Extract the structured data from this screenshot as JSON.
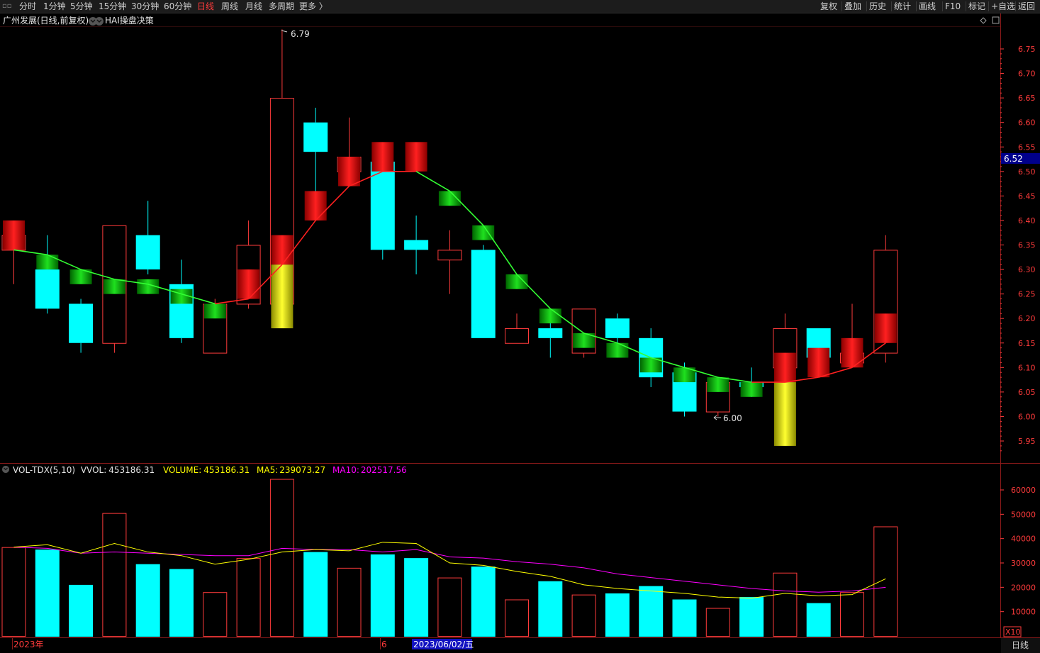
{
  "toolbar": {
    "left": [
      "分时",
      "1分钟",
      "5分钟",
      "15分钟",
      "30分钟",
      "60分钟",
      "日线",
      "周线",
      "月线",
      "多周期",
      "更多 〉"
    ],
    "active": "日线",
    "right": [
      "复权",
      "叠加",
      "历史",
      "统计",
      "画线",
      "F10",
      "标记",
      "+自选",
      "返回"
    ]
  },
  "price_panel": {
    "stock_title": "广州发展(日线,前复权)",
    "indicator": "HAI操盘决策",
    "current_price": "6.52",
    "high_marker": "6.79",
    "low_marker": "6.00",
    "axis_ticks": [
      "6.75",
      "6.70",
      "6.65",
      "6.60",
      "6.55",
      "6.50",
      "6.45",
      "6.40",
      "6.35",
      "6.30",
      "6.25",
      "6.20",
      "6.15",
      "6.10",
      "6.05",
      "6.00",
      "5.95"
    ]
  },
  "volume_panel": {
    "title": "VOL-TDX(5,10)",
    "vvol_label": "VVOL:",
    "vvol_value": "453186.31",
    "volume_label": "VOLUME:",
    "volume_value": "453186.31",
    "ma5_label": "MA5:",
    "ma5_value": "239073.27",
    "ma10_label": "MA10:",
    "ma10_value": "202517.56",
    "axis_ticks": [
      "60000",
      "50000",
      "40000",
      "30000",
      "20000",
      "10000"
    ],
    "multiplier": "X10"
  },
  "date_bar": {
    "year_label": "2023年",
    "month_label": "6",
    "cursor_date": "2023/06/02/五",
    "period": "日线"
  },
  "colors": {
    "up": "#ff3b3b",
    "down": "#00ffff",
    "hai_up": "#ff1a1a",
    "hai_down": "#17c817",
    "hai_vol": "#ffff00",
    "ma_up": "#ff2020",
    "ma_down": "#33ff33",
    "ma5": "#ffff00",
    "ma10": "#ff00ff",
    "axis": "#ff3b3b",
    "current_bg": "#00008b"
  },
  "chart_data": {
    "type": "candlestick",
    "title": "广州发展(日线,前复权)",
    "ylim": [
      5.92,
      6.8
    ],
    "candles": [
      {
        "o": 6.34,
        "c": 6.37,
        "h": 6.38,
        "l": 6.27
      },
      {
        "o": 6.3,
        "c": 6.22,
        "h": 6.37,
        "l": 6.21
      },
      {
        "o": 6.23,
        "c": 6.15,
        "h": 6.24,
        "l": 6.13
      },
      {
        "o": 6.15,
        "c": 6.39,
        "h": 6.39,
        "l": 6.13
      },
      {
        "o": 6.37,
        "c": 6.3,
        "h": 6.44,
        "l": 6.29
      },
      {
        "o": 6.27,
        "c": 6.16,
        "h": 6.32,
        "l": 6.15
      },
      {
        "o": 6.13,
        "c": 6.23,
        "h": 6.24,
        "l": 6.13
      },
      {
        "o": 6.23,
        "c": 6.35,
        "h": 6.4,
        "l": 6.22
      },
      {
        "o": 6.23,
        "c": 6.65,
        "h": 6.79,
        "l": 6.21
      },
      {
        "o": 6.6,
        "c": 6.54,
        "h": 6.63,
        "l": 6.42
      },
      {
        "o": 6.5,
        "c": 6.53,
        "h": 6.61,
        "l": 6.48
      },
      {
        "o": 6.52,
        "c": 6.34,
        "h": 6.53,
        "l": 6.32
      },
      {
        "o": 6.36,
        "c": 6.34,
        "h": 6.41,
        "l": 6.29
      },
      {
        "o": 6.32,
        "c": 6.34,
        "h": 6.38,
        "l": 6.25
      },
      {
        "o": 6.34,
        "c": 6.16,
        "h": 6.35,
        "l": 6.16
      },
      {
        "o": 6.15,
        "c": 6.18,
        "h": 6.21,
        "l": 6.15
      },
      {
        "o": 6.18,
        "c": 6.16,
        "h": 6.22,
        "l": 6.12
      },
      {
        "o": 6.13,
        "c": 6.22,
        "h": 6.22,
        "l": 6.12
      },
      {
        "o": 6.2,
        "c": 6.16,
        "h": 6.21,
        "l": 6.15
      },
      {
        "o": 6.16,
        "c": 6.08,
        "h": 6.18,
        "l": 6.06
      },
      {
        "o": 6.09,
        "c": 6.01,
        "h": 6.11,
        "l": 6.0
      },
      {
        "o": 6.01,
        "c": 6.07,
        "h": 6.07,
        "l": 6.0
      },
      {
        "o": 6.07,
        "c": 6.06,
        "h": 6.1,
        "l": 6.04
      },
      {
        "o": 6.1,
        "c": 6.18,
        "h": 6.21,
        "l": 6.06
      },
      {
        "o": 6.18,
        "c": 6.12,
        "h": 6.18,
        "l": 6.11
      },
      {
        "o": 6.11,
        "c": 6.13,
        "h": 6.23,
        "l": 6.11
      },
      {
        "o": 6.13,
        "c": 6.34,
        "h": 6.37,
        "l": 6.11
      }
    ],
    "hai_blocks": [
      {
        "top": 6.4,
        "bottom": 6.34,
        "dir": "up",
        "vol": false
      },
      {
        "top": 6.33,
        "bottom": 6.3,
        "dir": "down",
        "vol": false
      },
      {
        "top": 6.3,
        "bottom": 6.27,
        "dir": "down",
        "vol": false
      },
      {
        "top": 6.28,
        "bottom": 6.25,
        "dir": "down",
        "vol": false
      },
      {
        "top": 6.28,
        "bottom": 6.25,
        "dir": "down",
        "vol": false
      },
      {
        "top": 6.26,
        "bottom": 6.23,
        "dir": "down",
        "vol": false
      },
      {
        "top": 6.23,
        "bottom": 6.2,
        "dir": "down",
        "vol": false
      },
      {
        "top": 6.3,
        "bottom": 6.24,
        "dir": "up",
        "vol": false
      },
      {
        "top": 6.37,
        "bottom": 6.31,
        "dir": "up",
        "vol": true,
        "vol_bottom": 6.18
      },
      {
        "top": 6.46,
        "bottom": 6.4,
        "dir": "up",
        "vol": false
      },
      {
        "top": 6.53,
        "bottom": 6.47,
        "dir": "up",
        "vol": false
      },
      {
        "top": 6.56,
        "bottom": 6.5,
        "dir": "up",
        "vol": false
      },
      {
        "top": 6.56,
        "bottom": 6.5,
        "dir": "up",
        "vol": false
      },
      {
        "top": 6.46,
        "bottom": 6.43,
        "dir": "down",
        "vol": false
      },
      {
        "top": 6.39,
        "bottom": 6.36,
        "dir": "down",
        "vol": false
      },
      {
        "top": 6.29,
        "bottom": 6.26,
        "dir": "down",
        "vol": false
      },
      {
        "top": 6.22,
        "bottom": 6.19,
        "dir": "down",
        "vol": false
      },
      {
        "top": 6.17,
        "bottom": 6.14,
        "dir": "down",
        "vol": false
      },
      {
        "top": 6.15,
        "bottom": 6.12,
        "dir": "down",
        "vol": false
      },
      {
        "top": 6.12,
        "bottom": 6.09,
        "dir": "down",
        "vol": false
      },
      {
        "top": 6.1,
        "bottom": 6.07,
        "dir": "down",
        "vol": false
      },
      {
        "top": 6.08,
        "bottom": 6.05,
        "dir": "down",
        "vol": false
      },
      {
        "top": 6.07,
        "bottom": 6.04,
        "dir": "down",
        "vol": false
      },
      {
        "top": 6.13,
        "bottom": 6.07,
        "dir": "up",
        "vol": true,
        "vol_bottom": 5.94
      },
      {
        "top": 6.14,
        "bottom": 6.08,
        "dir": "up",
        "vol": false
      },
      {
        "top": 6.16,
        "bottom": 6.1,
        "dir": "up",
        "vol": false
      },
      {
        "top": 6.21,
        "bottom": 6.15,
        "dir": "up",
        "vol": false
      }
    ],
    "hai_line": [
      6.34,
      6.33,
      6.3,
      6.28,
      6.27,
      6.25,
      6.23,
      6.24,
      6.31,
      6.4,
      6.47,
      6.5,
      6.5,
      6.46,
      6.39,
      6.29,
      6.22,
      6.17,
      6.15,
      6.12,
      6.1,
      6.08,
      6.07,
      6.07,
      6.08,
      6.1,
      6.15
    ],
    "volume": [
      36500,
      35500,
      21000,
      50500,
      29500,
      27500,
      18000,
      32000,
      64500,
      34500,
      28000,
      33500,
      32000,
      24000,
      28500,
      15000,
      22500,
      17000,
      17500,
      20500,
      15000,
      11500,
      16000,
      26000,
      13500,
      18000,
      45000
    ],
    "ma5": [
      36500,
      37500,
      34000,
      38000,
      34500,
      33000,
      29500,
      31500,
      34500,
      35500,
      35000,
      38500,
      38000,
      30000,
      29000,
      26500,
      24500,
      21000,
      19500,
      18500,
      17500,
      16000,
      15500,
      17500,
      16500,
      17000,
      23500
    ],
    "ma10": [
      36500,
      36000,
      34000,
      34500,
      34000,
      33500,
      33000,
      33000,
      36000,
      35500,
      35500,
      34500,
      35500,
      32500,
      32000,
      30500,
      29500,
      28000,
      25500,
      24000,
      22500,
      21000,
      19500,
      18500,
      18000,
      18500,
      20000
    ],
    "vol_ylim": [
      0,
      66000
    ]
  }
}
